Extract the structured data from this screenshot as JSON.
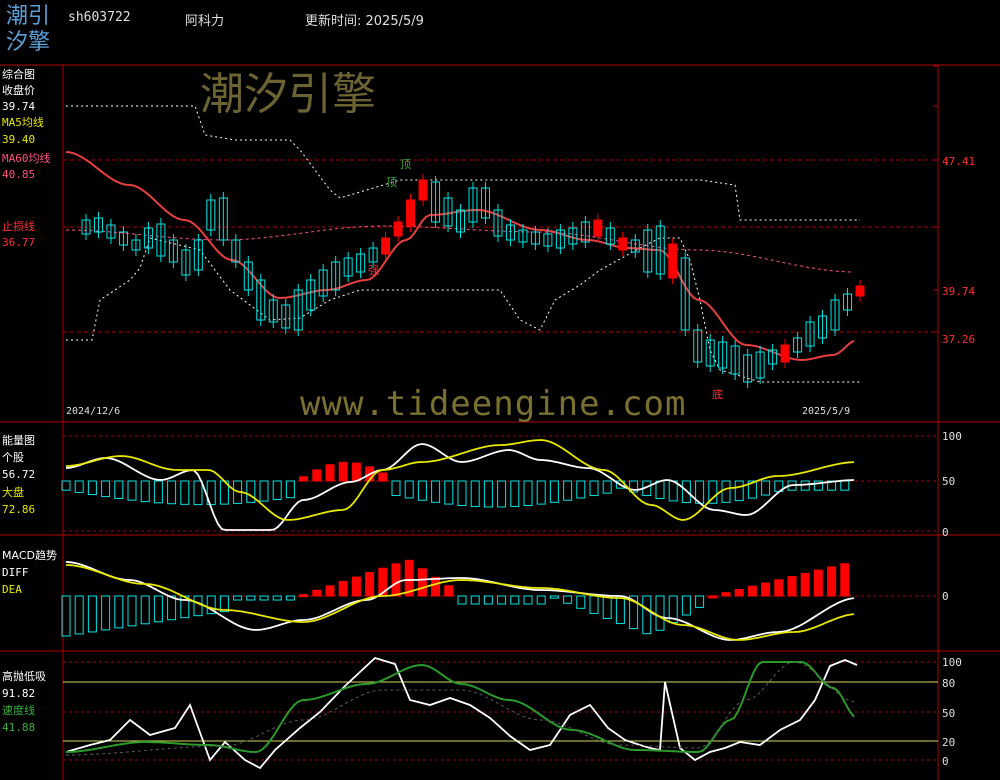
{
  "header": {
    "logo_line1": "潮引",
    "logo_line2": "汐擎",
    "code": "sh603722",
    "name": "阿科力",
    "update_label": "更新时间: 2025/5/9"
  },
  "watermark": {
    "brand": "潮汐引擎",
    "url": "www.tideengine.com"
  },
  "colors": {
    "bg": "#000000",
    "grid": "#b00000",
    "up": "#ff0000",
    "down": "#00e5e5",
    "ma5": "#e8e800",
    "ma60": "#e84040",
    "stop": "#ff3030",
    "white": "#ffffff",
    "green": "#2a9a2a"
  },
  "panel_main": {
    "title": "综合图",
    "close_label": "收盘价",
    "close_value": "39.74",
    "ma5_label": "MA5均线",
    "ma5_value": "39.40",
    "ma60_label": "MA60均线",
    "ma60_value": "40.85",
    "stop_label": "止损线",
    "stop_value": "36.77",
    "axis_labels": [
      "47.41",
      "39.74",
      "37.26"
    ],
    "date_start": "2024/12/6",
    "date_end": "2025/5/9",
    "markers": {
      "top1": "顶",
      "top2": "顶",
      "strong": "强",
      "bottom": "底"
    }
  },
  "panel_energy": {
    "title": "能量图",
    "stock_label": "个股",
    "stock_value": "56.72",
    "market_label": "大盘",
    "market_value": "72.86",
    "axis_labels": [
      "100",
      "50",
      "0"
    ]
  },
  "panel_macd": {
    "title": "MACD趋势",
    "diff_label": "DIFF",
    "dea_label": "DEA",
    "axis_labels": [
      "0"
    ]
  },
  "panel_kdj": {
    "title": "高抛低吸",
    "value": "91.82",
    "speed_label": "速度线",
    "speed_value": "41.88",
    "axis_labels": [
      "100",
      "80",
      "50",
      "20",
      "0"
    ]
  }
}
